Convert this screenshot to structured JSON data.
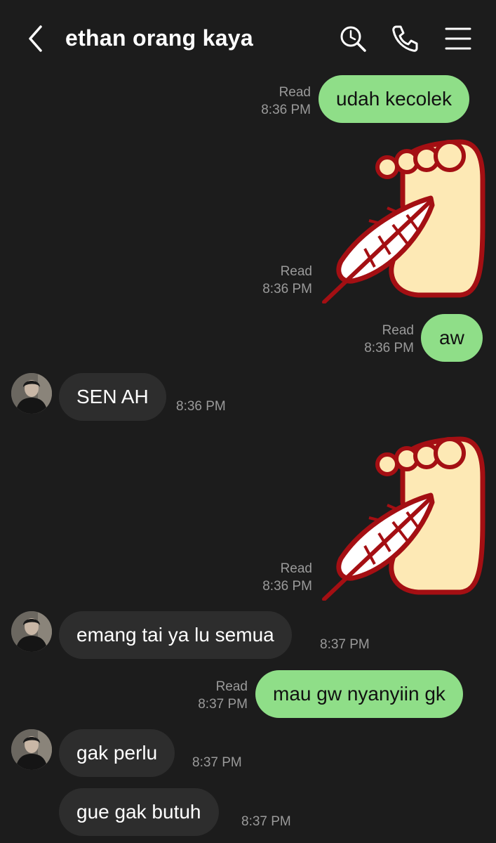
{
  "header": {
    "title": "ethan orang kaya"
  },
  "messages": [
    {
      "from": "me",
      "kind": "text",
      "text": "udah kecolek",
      "read": "Read",
      "time": "8:36 PM"
    },
    {
      "from": "me",
      "kind": "sticker",
      "sticker": "foot-feather-tickle-sticker",
      "read": "Read",
      "time": "8:36 PM"
    },
    {
      "from": "me",
      "kind": "text",
      "text": "aw",
      "read": "Read",
      "time": "8:36 PM"
    },
    {
      "from": "them",
      "kind": "text",
      "text": "SEN AH",
      "time": "8:36 PM"
    },
    {
      "from": "me",
      "kind": "sticker",
      "sticker": "foot-feather-tickle-sticker",
      "read": "Read",
      "time": "8:36 PM"
    },
    {
      "from": "them",
      "kind": "text",
      "text": "emang tai ya lu semua",
      "time": "8:37 PM"
    },
    {
      "from": "me",
      "kind": "text",
      "text": "mau gw nyanyiin gk",
      "read": "Read",
      "time": "8:37 PM"
    },
    {
      "from": "them",
      "kind": "text",
      "text": "gak perlu",
      "time": "8:37 PM"
    },
    {
      "from": "them",
      "kind": "text",
      "text": "gue gak butuh",
      "time": "8:37 PM"
    }
  ],
  "colors": {
    "background": "#1c1c1c",
    "my_bubble": "#8fde88",
    "their_bubble": "#2d2d2d",
    "meta_text": "#9a9a9a"
  }
}
